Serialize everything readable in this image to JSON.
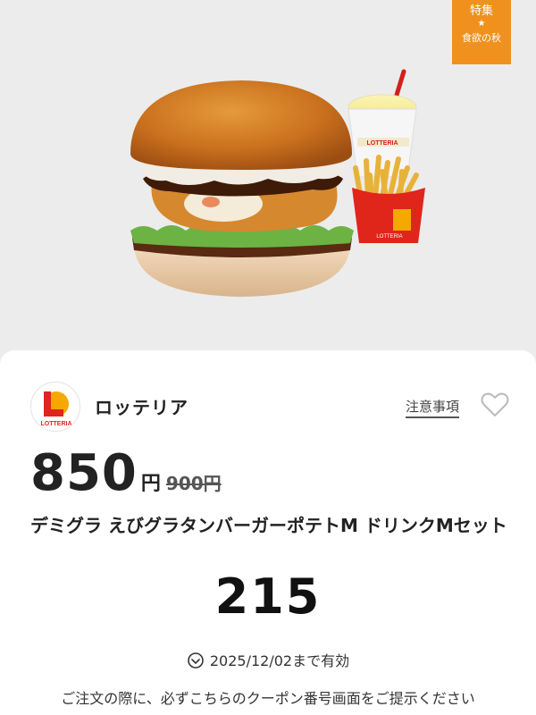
{
  "hero": {
    "badge": {
      "top": "特集",
      "bottom": "食欲の秋"
    },
    "cup_brand": "LOTTERIA",
    "fries_brand": "LOTTERIA"
  },
  "shop": {
    "logo_text": "LOTTERIA",
    "name": "ロッテリア",
    "notice_link": "注意事項"
  },
  "offer": {
    "price": "850",
    "unit": "円",
    "original_price": "900円",
    "title": "デミグラ えびグラタンバーガーポテトM ドリンクMセット",
    "coupon_code": "215",
    "expiry": "2025/12/02まで有効",
    "instruction": "ご注文の際に、必ずこちらのクーポン番号画面をご提示ください"
  },
  "colors": {
    "badge": "#f0911e",
    "brand_red": "#e0251b",
    "brand_yellow": "#f5a800"
  }
}
